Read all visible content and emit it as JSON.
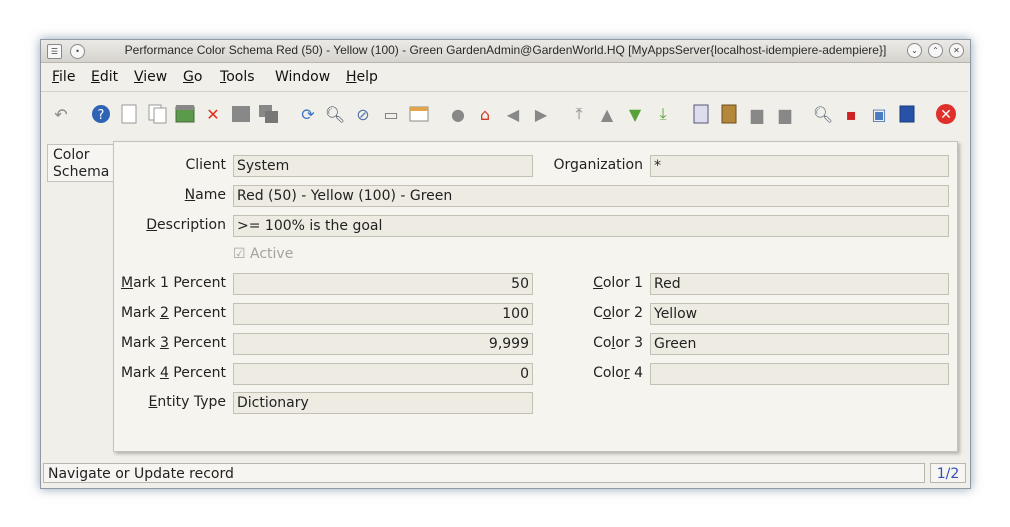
{
  "window": {
    "title": "Performance Color Schema  Red (50) - Yellow (100) - Green  GardenAdmin@GardenWorld.HQ [MyAppsServer{localhost-idempiere-adempiere}]"
  },
  "menu": [
    "File",
    "Edit",
    "View",
    "Go",
    "Tools",
    "Window",
    "Help"
  ],
  "toolbar": {
    "icons": [
      "undo-icon",
      "help-icon",
      "new-record-icon",
      "copy-record-icon",
      "save-icon",
      "delete-icon",
      "grid-toggle-icon",
      "multi-window-icon",
      "refresh-icon",
      "find-icon",
      "attachment-icon",
      "chat-icon",
      "history-icon",
      "menu-icon",
      "home-icon",
      "previous-arrow-icon",
      "next-arrow-icon",
      "first-record-icon",
      "up-record-icon",
      "down-record-icon",
      "last-record-icon",
      "report-icon",
      "archive-icon",
      "print-preview-icon",
      "print-icon",
      "zoom-across-icon",
      "workflow-icon",
      "request-icon",
      "product-info-icon",
      "exit-icon"
    ]
  },
  "tab": {
    "label_line1": "Color",
    "label_line2": "Schema"
  },
  "form": {
    "client": {
      "label": "Client",
      "value": "System"
    },
    "organization": {
      "label": "Organization",
      "value": "*"
    },
    "name": {
      "label_u": "N",
      "label_rest": "ame",
      "value": "Red (50) - Yellow (100) - Green"
    },
    "description": {
      "label_u": "D",
      "label_rest": "escription",
      "value": ">= 100% is the goal"
    },
    "active": {
      "label": "Active",
      "checked": true
    },
    "mark1": {
      "label_u": "M",
      "label_rest": "ark 1 Percent",
      "value": "50"
    },
    "mark2": {
      "label_pre": "Mark ",
      "label_u": "2",
      "label_rest": " Percent",
      "value": "100"
    },
    "mark3": {
      "label_pre": "Mark ",
      "label_u": "3",
      "label_rest": " Percent",
      "value": "9,999"
    },
    "mark4": {
      "label_pre": "Mark ",
      "label_u": "4",
      "label_rest": " Percent",
      "value": "0"
    },
    "entity_type": {
      "label_u": "E",
      "label_rest": "ntity Type",
      "value": "Dictionary"
    },
    "color1": {
      "label_u": "C",
      "label_rest": "olor 1",
      "value": "Red"
    },
    "color2": {
      "label_pre": "C",
      "label_u": "o",
      "label_rest": "lor 2",
      "value": "Yellow"
    },
    "color3": {
      "label_pre": "Co",
      "label_u": "l",
      "label_rest": "or 3",
      "value": "Green"
    },
    "color4": {
      "label_pre": "Colo",
      "label_u": "r",
      "label_rest": " 4",
      "value": ""
    }
  },
  "status": {
    "message": "Navigate or Update record",
    "page": "1/2"
  }
}
